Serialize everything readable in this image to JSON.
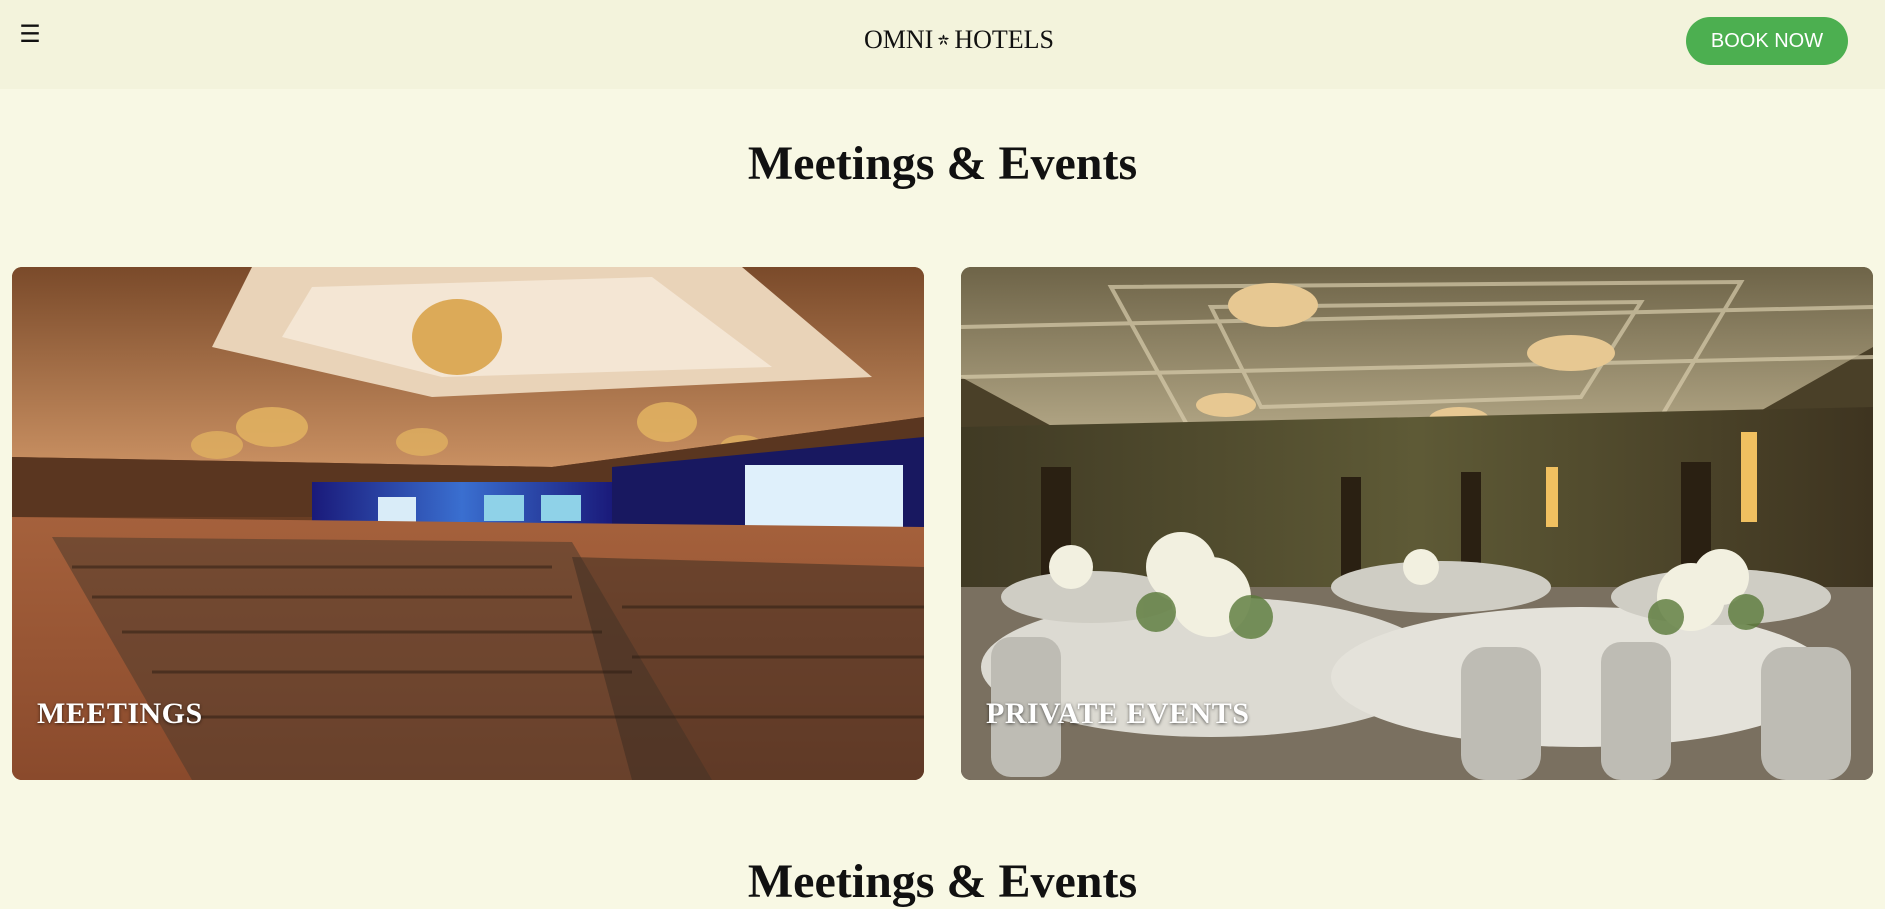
{
  "header": {
    "menu_icon": "hamburger-menu-icon",
    "logo_text_left": "OMNI",
    "logo_text_right": "HOTELS",
    "book_label": "BOOK NOW",
    "book_color": "#4caf50"
  },
  "main": {
    "section_title": "Meetings & Events",
    "cards": [
      {
        "label": "MEETINGS",
        "image": "conference-ballroom-image"
      },
      {
        "label": "PRIVATE EVENTS",
        "image": "banquet-ballroom-image"
      }
    ],
    "section_title_2": "Meetings & Events"
  },
  "colors": {
    "page_bg": "#f8f8e4",
    "header_bg": "#f3f3dc",
    "accent": "#4caf50"
  }
}
